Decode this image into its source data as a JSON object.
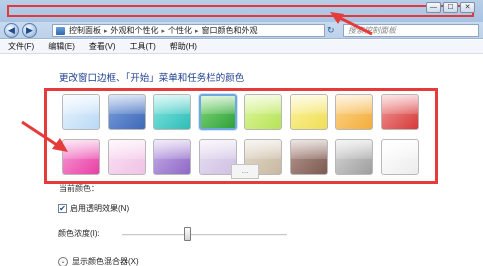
{
  "window": {
    "minimize_glyph": "—",
    "maximize_glyph": "☐",
    "close_glyph": "✕"
  },
  "address": {
    "back_glyph": "◀",
    "forward_glyph": "▶",
    "crumbs": [
      "控制面板",
      "外观和个性化",
      "个性化",
      "窗口颜色和外观"
    ],
    "separator": "▸",
    "refresh_glyph": "↻",
    "search_placeholder": "搜索控制面板"
  },
  "menu": {
    "items": [
      "文件(F)",
      "编辑(E)",
      "查看(V)",
      "工具(T)",
      "帮助(H)"
    ]
  },
  "main": {
    "heading": "更改窗口边框、「开始」菜单和任务栏的颜色",
    "swatches": [
      {
        "name": "sky",
        "colors": [
          "#eaf5ff",
          "#b9d9f5"
        ]
      },
      {
        "name": "twilight",
        "colors": [
          "#7ea3df",
          "#3e68b8"
        ]
      },
      {
        "name": "sea",
        "colors": [
          "#86e6e0",
          "#2fbdb8"
        ]
      },
      {
        "name": "leaf",
        "colors": [
          "#86d979",
          "#2ea13b"
        ]
      },
      {
        "name": "lime",
        "colors": [
          "#dff7a0",
          "#b7e358"
        ]
      },
      {
        "name": "lemon",
        "colors": [
          "#fbf3a2",
          "#f0df55"
        ]
      },
      {
        "name": "pumpkin",
        "colors": [
          "#fcd78e",
          "#f3ad3c"
        ]
      },
      {
        "name": "ruby",
        "colors": [
          "#f29a9a",
          "#d63a3a"
        ]
      },
      {
        "name": "fuchsia",
        "colors": [
          "#f7a0d8",
          "#e93fa5"
        ]
      },
      {
        "name": "blush",
        "colors": [
          "#fbe2f4",
          "#f0c2e6"
        ]
      },
      {
        "name": "violet",
        "colors": [
          "#c9b1ea",
          "#8e68c6"
        ]
      },
      {
        "name": "lavender",
        "colors": [
          "#e8e0f2",
          "#cfc0e3"
        ]
      },
      {
        "name": "taupe",
        "colors": [
          "#e5dccd",
          "#c7b8a0"
        ]
      },
      {
        "name": "chocolate",
        "colors": [
          "#b89a93",
          "#7d5a52"
        ]
      },
      {
        "name": "slate",
        "colors": [
          "#d9d9d9",
          "#9e9e9e"
        ]
      },
      {
        "name": "frost",
        "colors": [
          "#ffffff",
          "#ececec"
        ]
      }
    ],
    "current_color_label": "当前颜色：",
    "transparency_label": "启用透明效果(N)",
    "transparency_checked": true,
    "checkbox_glyph": "✔",
    "intensity_label": "颜色浓度(I):",
    "mixer_label": "显示颜色混合器(X)",
    "mixer_glyph": "⌄",
    "tooltip_text": "…"
  },
  "annotation": {
    "highlight_color": "#e53b3b"
  }
}
